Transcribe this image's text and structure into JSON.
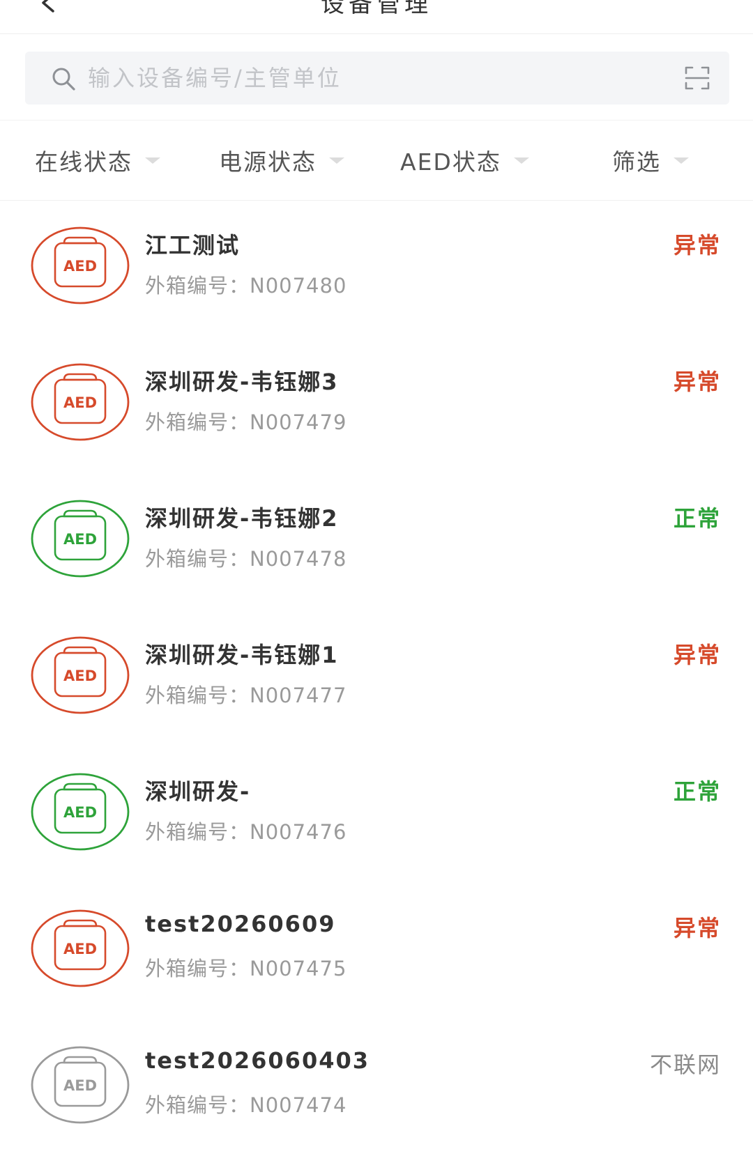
{
  "header": {
    "title": "设备管理",
    "back_icon": "chevron-left-icon"
  },
  "search": {
    "placeholder": "输入设备编号/主管单位",
    "value": "",
    "icon": "search-icon",
    "scan_icon": "scan-icon"
  },
  "filters": [
    {
      "label": "在线状态"
    },
    {
      "label": "电源状态"
    },
    {
      "label": "AED状态"
    },
    {
      "label": "筛选"
    }
  ],
  "colors": {
    "abnormal": "#d64a2b",
    "normal": "#2ea33a",
    "offline": "#9a9a9a"
  },
  "devices": [
    {
      "name": "江工测试",
      "box_label": "外箱编号：",
      "box_no": "N007480",
      "status": "异常",
      "state": "abnormal",
      "icon_text": "AED"
    },
    {
      "name": "深圳研发-韦钰娜3",
      "box_label": "外箱编号：",
      "box_no": "N007479",
      "status": "异常",
      "state": "abnormal",
      "icon_text": "AED"
    },
    {
      "name": "深圳研发-韦钰娜2",
      "box_label": "外箱编号：",
      "box_no": "N007478",
      "status": "正常",
      "state": "normal",
      "icon_text": "AED"
    },
    {
      "name": "深圳研发-韦钰娜1",
      "box_label": "外箱编号：",
      "box_no": "N007477",
      "status": "异常",
      "state": "abnormal",
      "icon_text": "AED"
    },
    {
      "name": "深圳研发-",
      "box_label": "外箱编号：",
      "box_no": "N007476",
      "status": "正常",
      "state": "normal",
      "icon_text": "AED"
    },
    {
      "name": "test20260609",
      "box_label": "外箱编号：",
      "box_no": "N007475",
      "status": "异常",
      "state": "abnormal",
      "icon_text": "AED"
    },
    {
      "name": "test2026060403",
      "box_label": "外箱编号：",
      "box_no": "N007474",
      "status": "不联网",
      "state": "offline",
      "icon_text": "AED"
    }
  ]
}
